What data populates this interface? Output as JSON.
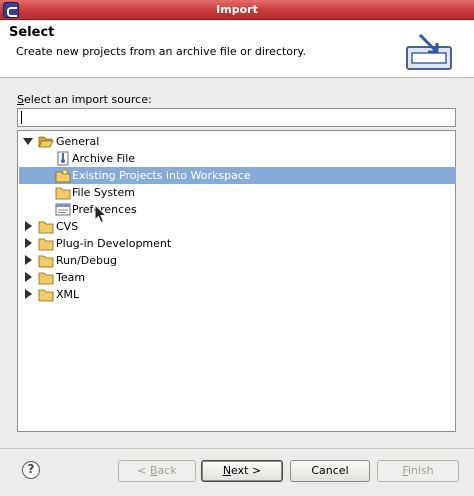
{
  "window": {
    "title": "Import"
  },
  "header": {
    "title": "Select",
    "description": "Create new projects from an archive file or directory."
  },
  "source": {
    "label_prefix": "",
    "label_mnemonic": "S",
    "label_rest": "elect an import source:",
    "filter_value": ""
  },
  "tree": {
    "items": [
      {
        "label": "General",
        "kind": "folder",
        "expanded": true,
        "depth": 0
      },
      {
        "label": "Archive File",
        "kind": "archive",
        "depth": 1
      },
      {
        "label": "Existing Projects into Workspace",
        "kind": "project",
        "depth": 1,
        "selected": true
      },
      {
        "label": "File System",
        "kind": "filesystem",
        "depth": 1
      },
      {
        "label": "Preferences",
        "kind": "preferences",
        "depth": 1
      },
      {
        "label": "CVS",
        "kind": "folder",
        "expanded": false,
        "depth": 0
      },
      {
        "label": "Plug-in Development",
        "kind": "folder",
        "expanded": false,
        "depth": 0
      },
      {
        "label": "Run/Debug",
        "kind": "folder",
        "expanded": false,
        "depth": 0
      },
      {
        "label": "Team",
        "kind": "folder",
        "expanded": false,
        "depth": 0
      },
      {
        "label": "XML",
        "kind": "folder",
        "expanded": false,
        "depth": 0
      }
    ]
  },
  "buttons": {
    "help": "?",
    "back_arrow": "< ",
    "back_mnemonic": "B",
    "back_rest": "ack",
    "next_mnemonic": "N",
    "next_rest": "ext >",
    "cancel": "Cancel",
    "finish_mnemonic": "F",
    "finish_rest": "inish"
  },
  "colors": {
    "titlebar": "#c73b3b",
    "selection": "#86abd9",
    "folder": "#e8b84a"
  }
}
